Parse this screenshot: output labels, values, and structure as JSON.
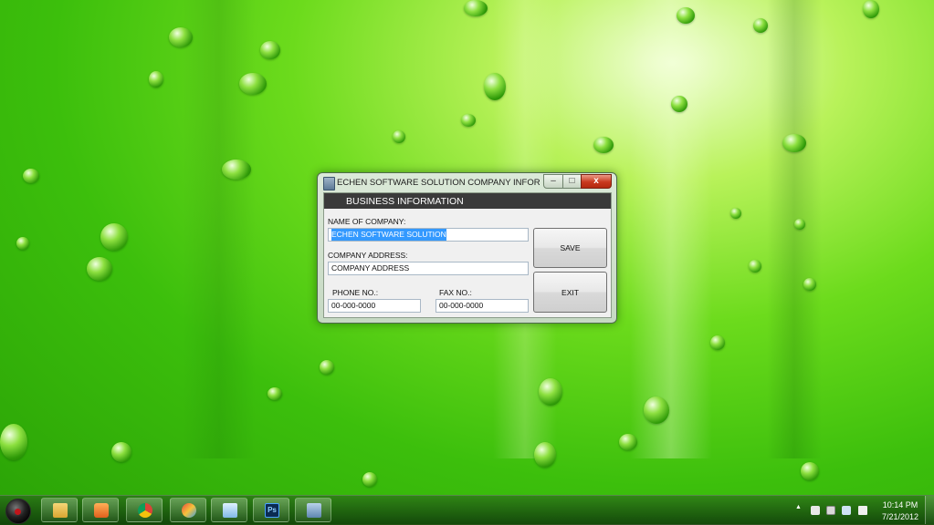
{
  "window": {
    "title": "ECHEN SOFTWARE SOLUTION COMPANY INFORMATI...",
    "minimize_glyph": "–",
    "maximize_glyph": "□",
    "close_glyph": "x"
  },
  "form": {
    "header": "BUSINESS INFORMATION",
    "company_name_label": "NAME OF COMPANY:",
    "company_name_value": "ECHEN SOFTWARE SOLUTION",
    "address_label": "COMPANY ADDRESS:",
    "address_value": "COMPANY ADDRESS",
    "phone_label": "PHONE NO.:",
    "phone_value": "00-000-0000",
    "fax_label": "FAX NO.:",
    "fax_value": "00-000-0000",
    "save_label": "SAVE",
    "exit_label": "EXIT"
  },
  "taskbar": {
    "items": [
      {
        "icon": "folder-icon"
      },
      {
        "icon": "media-player-icon"
      },
      {
        "icon": "chrome-icon"
      },
      {
        "icon": "paint-app-icon"
      },
      {
        "icon": "notepad-icon"
      },
      {
        "icon": "photoshop-icon",
        "label": "Ps"
      },
      {
        "icon": "database-app-icon"
      }
    ],
    "clock_time": "10:14 PM",
    "clock_date": "7/21/2012",
    "tray_arrow": "▲"
  },
  "colors": {
    "banner": "#3a3a3a",
    "selection": "#3399ff",
    "close_button": "#c9391f"
  }
}
